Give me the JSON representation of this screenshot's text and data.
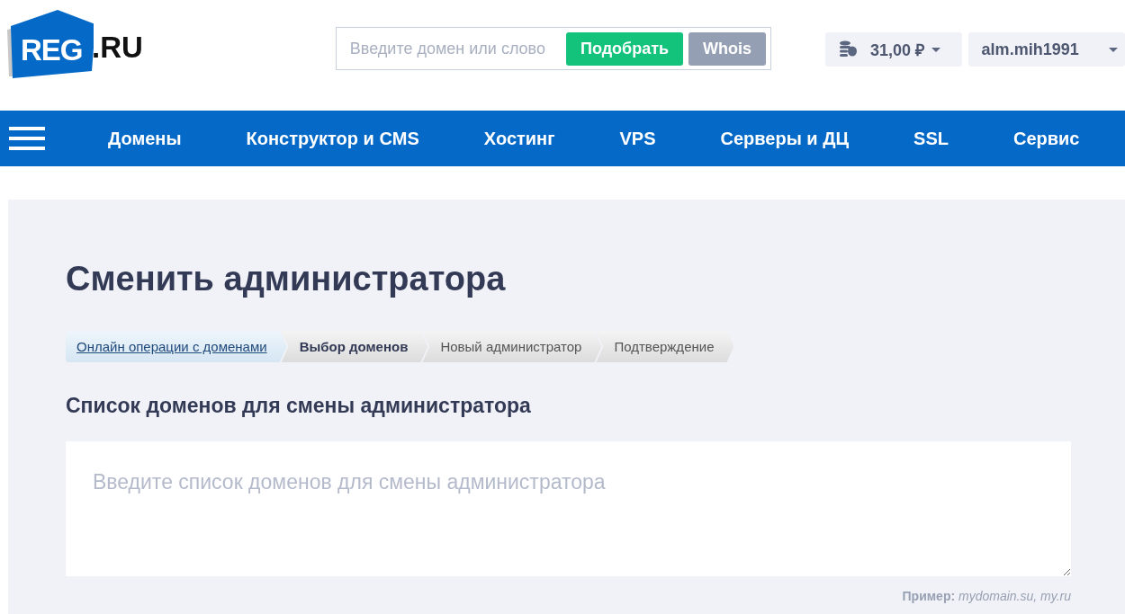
{
  "header": {
    "logo": {
      "mark": "REG",
      "suffix": ".RU"
    },
    "search": {
      "placeholder": "Введите домен или слово",
      "buttons": [
        {
          "label": "Подобрать",
          "kind": "primary"
        },
        {
          "label": "Whois",
          "kind": "secondary"
        }
      ]
    },
    "balance": "31,00 ₽",
    "user": "alm.mih1991"
  },
  "nav": {
    "items": [
      "Домены",
      "Конструктор и CMS",
      "Хостинг",
      "VPS",
      "Серверы и ДЦ",
      "SSL",
      "Сервис"
    ]
  },
  "page": {
    "title": "Сменить администратора",
    "steps": [
      {
        "label": "Онлайн операции с доменами",
        "kind": "link",
        "selected": false
      },
      {
        "label": "Выбор доменов",
        "kind": "step",
        "selected": true
      },
      {
        "label": "Новый администратор",
        "kind": "step",
        "selected": false
      },
      {
        "label": "Подтверждение",
        "kind": "step",
        "selected": false
      }
    ],
    "subtitle": "Список доменов для смены администратора",
    "domains_field": {
      "placeholder": "Введите список доменов для смены администратора"
    },
    "example": "**Пример:** *mydomain.su, my.ru*"
  }
}
